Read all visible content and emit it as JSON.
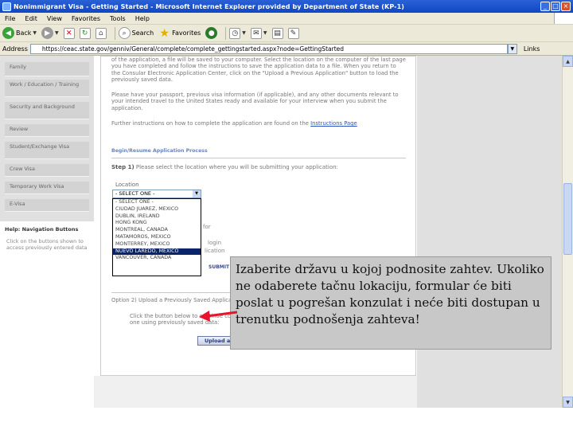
{
  "window": {
    "title": "Nonimmigrant Visa - Getting Started - Microsoft Internet Explorer provided by Department of State (KP-1)",
    "buttons": [
      "_",
      "□",
      "×"
    ]
  },
  "menu": [
    "File",
    "Edit",
    "View",
    "Favorites",
    "Tools",
    "Help"
  ],
  "toolbar": {
    "back_label": "Back",
    "search_label": "Search",
    "favorites_label": "Favorites"
  },
  "address": {
    "label": "Address",
    "url": "https://ceac.state.gov/genniv/General/complete/complete_gettingstarted.aspx?node=GettingStarted",
    "links_label": "Links"
  },
  "sidebar": {
    "items": [
      "Family",
      "Work / Education / Training",
      "Security and Background",
      "Review",
      "Student/Exchange Visa",
      "Crew Visa",
      "Temporary Work Visa",
      "E-Visa"
    ],
    "help_title": "Help: Navigation Buttons",
    "help_text": "Click on the buttons shown to access previously entered data"
  },
  "main": {
    "para1": "of the application, a file will be saved to your computer. Select the location on the computer of the last page you have completed and follow the instructions to save the application data to a file. When you return to the Consular Electronic Application Center, click on the \"Upload a Previous Application\" button to load the previously saved data.",
    "para2": "Please have your passport, previous visa information (if applicable), and any other documents relevant to your intended travel to the United States ready and available for your interview when you submit the application.",
    "para3_prefix": "Further instructions on how to complete the application are found on the",
    "para3_link": "Instructions Page",
    "section_heading": "Begin/Resume Application Process",
    "step1_bold": "Step 1)",
    "step1_text": "Please select the location where you will be submitting your application:",
    "location_label": "Location",
    "select_value": "- SELECT ONE -",
    "options": [
      "- SELECT ONE -",
      "CIUDAD JUAREZ, MEXICO",
      "DUBLIN, IRELAND",
      "HONG KONG",
      "MONTREAL, CANADA",
      "MATAMOROS, MEXICO",
      "MONTERREY, MEXICO",
      "NUEVO LAREDO, MEXICO",
      "VANCOUVER, CANADA"
    ],
    "selected_index": 7,
    "partial_text_1": "for",
    "partial_text_2": "login",
    "partial_text_3": "lication",
    "submit_stub": "SUBMIT",
    "option2_heading": "Option 2) Upload a Previously Saved Application",
    "option2_text": "Click the button below to continue completing an existing application or to start a new one using previously saved data:",
    "upload_button": "Upload a Previous Application"
  },
  "callout": {
    "text": "Izaberite državu u kojoj podnosite zahtev. Ukoliko ne odaberete tačnu lokaciju, formular će biti poslat u pogrešan konzulat i neće biti dostupan u trenutku podnošenja zahteva!",
    "arrow_color": "#e8142b"
  }
}
